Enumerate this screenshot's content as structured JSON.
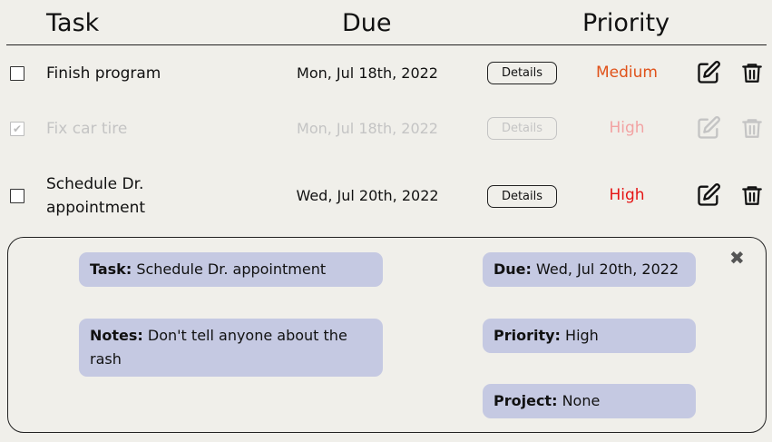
{
  "header": {
    "task": "Task",
    "due": "Due",
    "priority": "Priority"
  },
  "rows": [
    {
      "task": "Finish program",
      "due": "Mon, Jul 18th, 2022",
      "details": "Details",
      "priority": "Medium",
      "priority_color": "#e0521a",
      "done": false
    },
    {
      "task": "Fix car tire",
      "due": "Mon, Jul 18th, 2022",
      "details": "Details",
      "priority": "High",
      "priority_color": "#f2a3a3",
      "done": true
    },
    {
      "task": "Schedule Dr. appointment",
      "due": "Wed, Jul 20th, 2022",
      "details": "Details",
      "priority": "High",
      "priority_color": "#e51414",
      "done": false
    }
  ],
  "detail": {
    "task_label": "Task:",
    "task_value": "Schedule Dr. appointment",
    "notes_label": "Notes:",
    "notes_value": "Don't tell anyone about the rash",
    "due_label": "Due:",
    "due_value": "Wed, Jul 20th, 2022",
    "priority_label": "Priority:",
    "priority_value": "High",
    "project_label": "Project:",
    "project_value": "None",
    "close_icon": "✖"
  },
  "icons": {
    "edit": "edit-icon",
    "delete": "trash-icon"
  },
  "colors": {
    "background": "#f0efea",
    "chip": "#c5c9e2"
  }
}
